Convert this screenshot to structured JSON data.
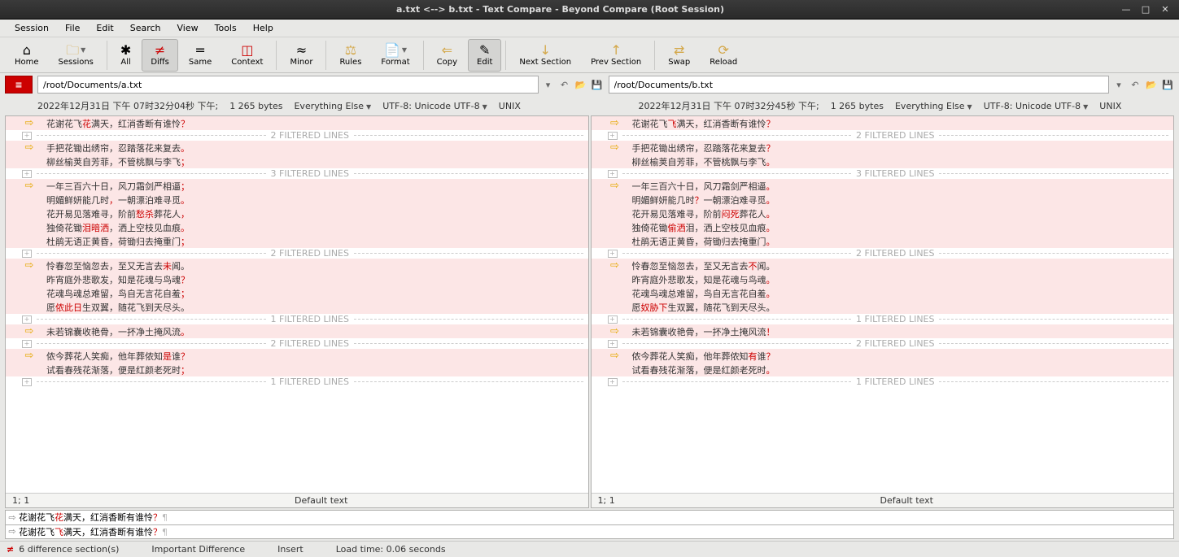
{
  "window": {
    "title": "a.txt <--> b.txt - Text Compare - Beyond Compare (Root Session)"
  },
  "menu": [
    "Session",
    "File",
    "Edit",
    "Search",
    "View",
    "Tools",
    "Help"
  ],
  "toolbar": {
    "home": "Home",
    "sessions": "Sessions",
    "all": "All",
    "diffs": "Diffs",
    "same": "Same",
    "context": "Context",
    "minor": "Minor",
    "rules": "Rules",
    "format": "Format",
    "copy": "Copy",
    "edit": "Edit",
    "next": "Next Section",
    "prev": "Prev Section",
    "swap": "Swap",
    "reload": "Reload"
  },
  "leftPath": "/root/Documents/a.txt",
  "rightPath": "/root/Documents/b.txt",
  "leftInfo": {
    "timestamp": "2022年12月31日 下午 07时32分04秒 下午;",
    "size": "1 265 bytes",
    "filter": "Everything Else",
    "encoding": "UTF-8: Unicode UTF-8",
    "lineend": "UNIX"
  },
  "rightInfo": {
    "timestamp": "2022年12月31日 下午 07时32分45秒 下午;",
    "size": "1 265 bytes",
    "filter": "Everything Else",
    "encoding": "UTF-8: Unicode UTF-8",
    "lineend": "UNIX"
  },
  "filteredLabels": {
    "f2": "2 FILTERED LINES",
    "f3": "3 FILTERED LINES",
    "f1": "1 FILTERED LINES"
  },
  "left": {
    "sections": [
      {
        "lines": [
          {
            "t": "花谢花飞",
            "h": "花",
            "t2": "满天，红消香断有谁怜",
            "h2": "？"
          }
        ]
      },
      {
        "filtered": "f2"
      },
      {
        "lines": [
          {
            "t": "手把花锄出绣帘，忍踏落花来复去",
            "h": "。"
          },
          {
            "t": "柳丝榆荚自芳菲，不管桃飘与李飞",
            "h": "；"
          }
        ]
      },
      {
        "filtered": "f3"
      },
      {
        "lines": [
          {
            "t": "一年三百六十日，风刀霜剑严相逼",
            "h": "；"
          },
          {
            "t": "明媚鲜妍能几时",
            "h": "，",
            "t2": "一朝漂泊难寻觅",
            "h2": "。"
          },
          {
            "t": "花开易见落难寻，阶前",
            "h": "愁杀",
            "t2": "葬花人",
            "h2": "，"
          },
          {
            "t": "独倚花锄",
            "h": "泪暗洒",
            "t2": "，洒上空枝见血痕",
            "h2": "。"
          },
          {
            "t": "杜鹃无语正黄昏，荷锄归去掩重门",
            "h": "；"
          }
        ]
      },
      {
        "filtered": "f2"
      },
      {
        "lines": [
          {
            "t": "怜春忽至恼忽去，至又无言去",
            "h": "未",
            "t2": "闻。"
          },
          {
            "t": "昨宵庭外悲歌发，知是花魂与鸟魂",
            "h": "？"
          },
          {
            "t": "花魂鸟魂总难留，鸟自无言花自羞",
            "h": "；"
          },
          {
            "t": "愿",
            "h": "侬此日",
            "t2": "生双翼，随花飞到天尽头。"
          }
        ]
      },
      {
        "filtered": "f1"
      },
      {
        "lines": [
          {
            "t": "未若锦囊收艳骨，一抔净土掩风流",
            "h": "。"
          }
        ]
      },
      {
        "filtered": "f2"
      },
      {
        "lines": [
          {
            "t": "侬今葬花人笑痴，他年葬侬知",
            "h": "是",
            "t2": "谁",
            "h2": "？"
          },
          {
            "t": "试看春残花渐落，便是红颜老死时",
            "h": "；"
          }
        ]
      },
      {
        "filtered": "f1"
      }
    ]
  },
  "right": {
    "sections": [
      {
        "lines": [
          {
            "t": "花谢花飞",
            "h": "飞",
            "t2": "满天，红消香断有谁怜",
            "h2": "？"
          }
        ]
      },
      {
        "filtered": "f2"
      },
      {
        "lines": [
          {
            "t": "手把花锄出绣帘，忍踏落花来复去",
            "h": "？"
          },
          {
            "t": "柳丝榆荚自芳菲，不管桃飘与李飞",
            "h": "。"
          }
        ]
      },
      {
        "filtered": "f3"
      },
      {
        "lines": [
          {
            "t": "一年三百六十日，风刀霜剑严相逼",
            "h": "。"
          },
          {
            "t": "明媚鲜妍能几时",
            "h": "？",
            "t2": "一朝漂泊难寻觅",
            "h2": "。"
          },
          {
            "t": "花开易见落难寻，阶前",
            "h": "闷死",
            "t2": "葬花人",
            "h2": "。"
          },
          {
            "t": "独倚花锄",
            "h": "偷洒",
            "t2": "泪，洒上空枝见血痕",
            "h2": "。"
          },
          {
            "t": "杜鹃无语正黄昏，荷锄归去掩重门",
            "h": "。"
          }
        ]
      },
      {
        "filtered": "f2"
      },
      {
        "lines": [
          {
            "t": "怜春忽至恼忽去，至又无言去",
            "h": "不",
            "t2": "闻。"
          },
          {
            "t": "昨宵庭外悲歌发，知是花魂与鸟魂",
            "h": "。"
          },
          {
            "t": "花魂鸟魂总难留，鸟自无言花自羞",
            "h": "。"
          },
          {
            "t": "愿",
            "h": "奴胁下",
            "t2": "生双翼，随花飞到天尽头。"
          }
        ]
      },
      {
        "filtered": "f1"
      },
      {
        "lines": [
          {
            "t": "未若锦囊收艳骨，一抔净土掩风流",
            "h": "！"
          }
        ]
      },
      {
        "filtered": "f2"
      },
      {
        "lines": [
          {
            "t": "侬今葬花人笑痴，他年葬侬知",
            "h": "有",
            "t2": "谁",
            "h2": "？"
          },
          {
            "t": "试看春残花渐落，便是红颜老死时",
            "h": "。"
          }
        ]
      },
      {
        "filtered": "f1"
      }
    ]
  },
  "paneStatus": {
    "pos": "1; 1",
    "label": "Default text"
  },
  "bottomCompare": {
    "line1": {
      "t": "花谢花飞",
      "h": "花",
      "t2": "满天，红消香断有谁怜",
      "h2": "？",
      "tail": "¶"
    },
    "line2": {
      "t": "花谢花飞",
      "h": "飞",
      "t2": "满天，红消香断有谁怜",
      "h2": "？",
      "tail": "¶"
    }
  },
  "status": {
    "diffCount": "6 difference section(s)",
    "diffType": "Important Difference",
    "mode": "Insert",
    "load": "Load time: 0.06 seconds"
  }
}
